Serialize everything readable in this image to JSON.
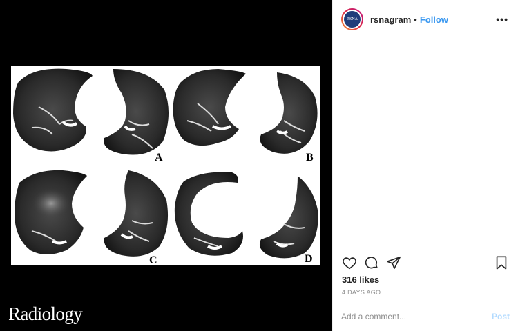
{
  "post": {
    "figure_labels": [
      "A",
      "B",
      "C",
      "D"
    ],
    "watermark": "Radiology"
  },
  "header": {
    "avatar_text": "RSNA",
    "username": "rsnagram",
    "separator": "•",
    "follow_label": "Follow",
    "more_label": "•••"
  },
  "actions": {
    "icons": [
      "heart-icon",
      "comment-icon",
      "share-icon",
      "bookmark-icon"
    ]
  },
  "stats": {
    "likes": "316 likes",
    "time": "4 DAYS AGO"
  },
  "comment": {
    "placeholder": "Add a comment...",
    "post_label": "Post"
  },
  "colors": {
    "follow": "#3897f0",
    "post_disabled": "#b3dbff",
    "secondary_text": "#8e8e8e"
  }
}
